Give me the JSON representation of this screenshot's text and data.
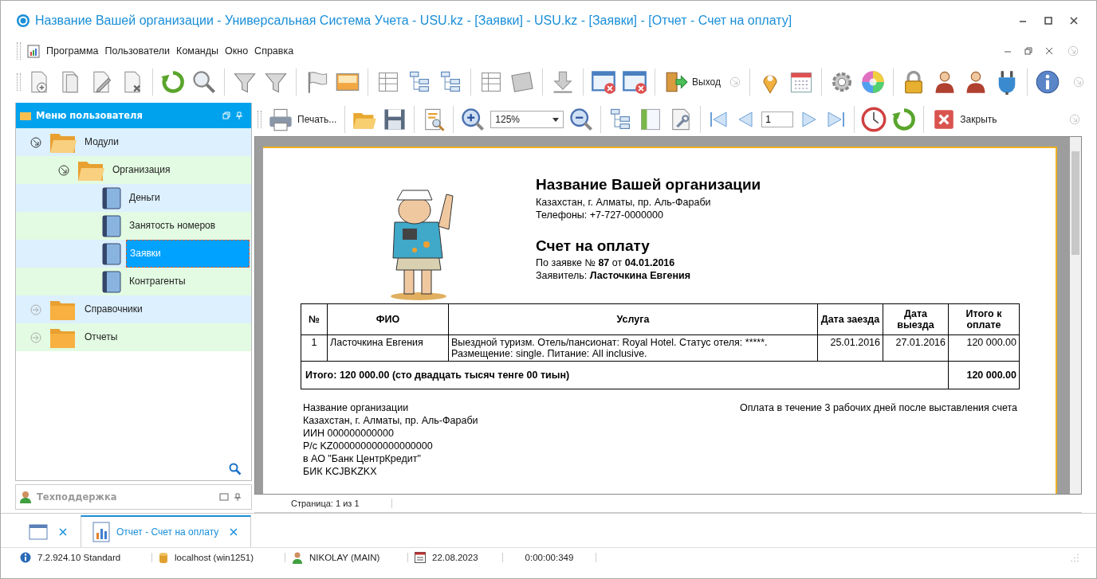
{
  "window": {
    "title": "Название Вашей организации - Универсальная Система Учета - USU.kz - [Заявки] - USU.kz - [Заявки] - [Отчет - Счет на оплату]"
  },
  "menu_bar": [
    "Программа",
    "Пользователи",
    "Команды",
    "Окно",
    "Справка"
  ],
  "toolbar": {
    "exit_label": "Выход"
  },
  "user_menu": {
    "title": "Меню пользователя",
    "tree": [
      {
        "label": "Модули",
        "expanded": true,
        "selected": false,
        "children": [
          {
            "label": "Организация",
            "expanded": true,
            "selected": false,
            "children": [
              {
                "label": "Деньги",
                "selected": false
              },
              {
                "label": "Занятость номеров",
                "selected": false
              },
              {
                "label": "Заявки",
                "selected": true
              },
              {
                "label": "Контрагенты",
                "selected": false
              }
            ]
          }
        ]
      },
      {
        "label": "Справочники",
        "expanded": false,
        "selected": false
      },
      {
        "label": "Отчеты",
        "expanded": false,
        "selected": false
      }
    ]
  },
  "support_panel": {
    "title": "Техподдержка"
  },
  "report_toolbar": {
    "print_label": "Печать...",
    "zoom": "125%",
    "page": "1",
    "close_label": "Закрыть"
  },
  "invoice": {
    "org_name": "Название Вашей организации",
    "org_address": "Казахстан, г. Алматы, пр. Аль-Фараби",
    "org_phones": "Телефоны: +7-727-0000000",
    "title": "Счет на оплату",
    "request_line": "По заявке № **87** от **04.01.2016**",
    "applicant": "Заявитель: **Ласточкина Евгения**",
    "table": {
      "columns": [
        "№",
        "ФИО",
        "Услуга",
        "Дата заезда",
        "Дата выезда",
        "Итого к оплате"
      ],
      "rows": [
        [
          "1",
          "Ласточкина Евгения",
          "Выездной туризм. Отель/пансионат: Royal Hotel. Статус отеля: *****. Размещение: single. Питание: All inclusive.",
          "25.01.2016",
          "27.01.2016",
          "120 000.00"
        ]
      ],
      "total_label": "Итого: 120 000.00 (сто двадцать тысяч тенге 00 тиын)",
      "total_value": "120 000.00"
    },
    "requisites": [
      "Название организации",
      "Казахстан, г. Алматы, пр. Аль-Фараби",
      "ИИН 000000000000",
      "Р/с KZ000000000000000000",
      "в АО \"Банк ЦентрКредит\"",
      "БИК KCJBKZKX"
    ],
    "payment_note": "Оплата в течение 3 рабочих дней после выставления счета"
  },
  "page_status": "Страница: 1 из 1",
  "tabs": [
    {
      "selected": false
    },
    {
      "label": "Отчет - Счет на оплату",
      "selected": true
    }
  ],
  "status_bar": {
    "version": "7.2.924.10 Standard",
    "server": "localhost (win1251)",
    "user": "NIKOLAY (MAIN)",
    "date": "22.08.2023",
    "timer": "0:00:00:349"
  }
}
